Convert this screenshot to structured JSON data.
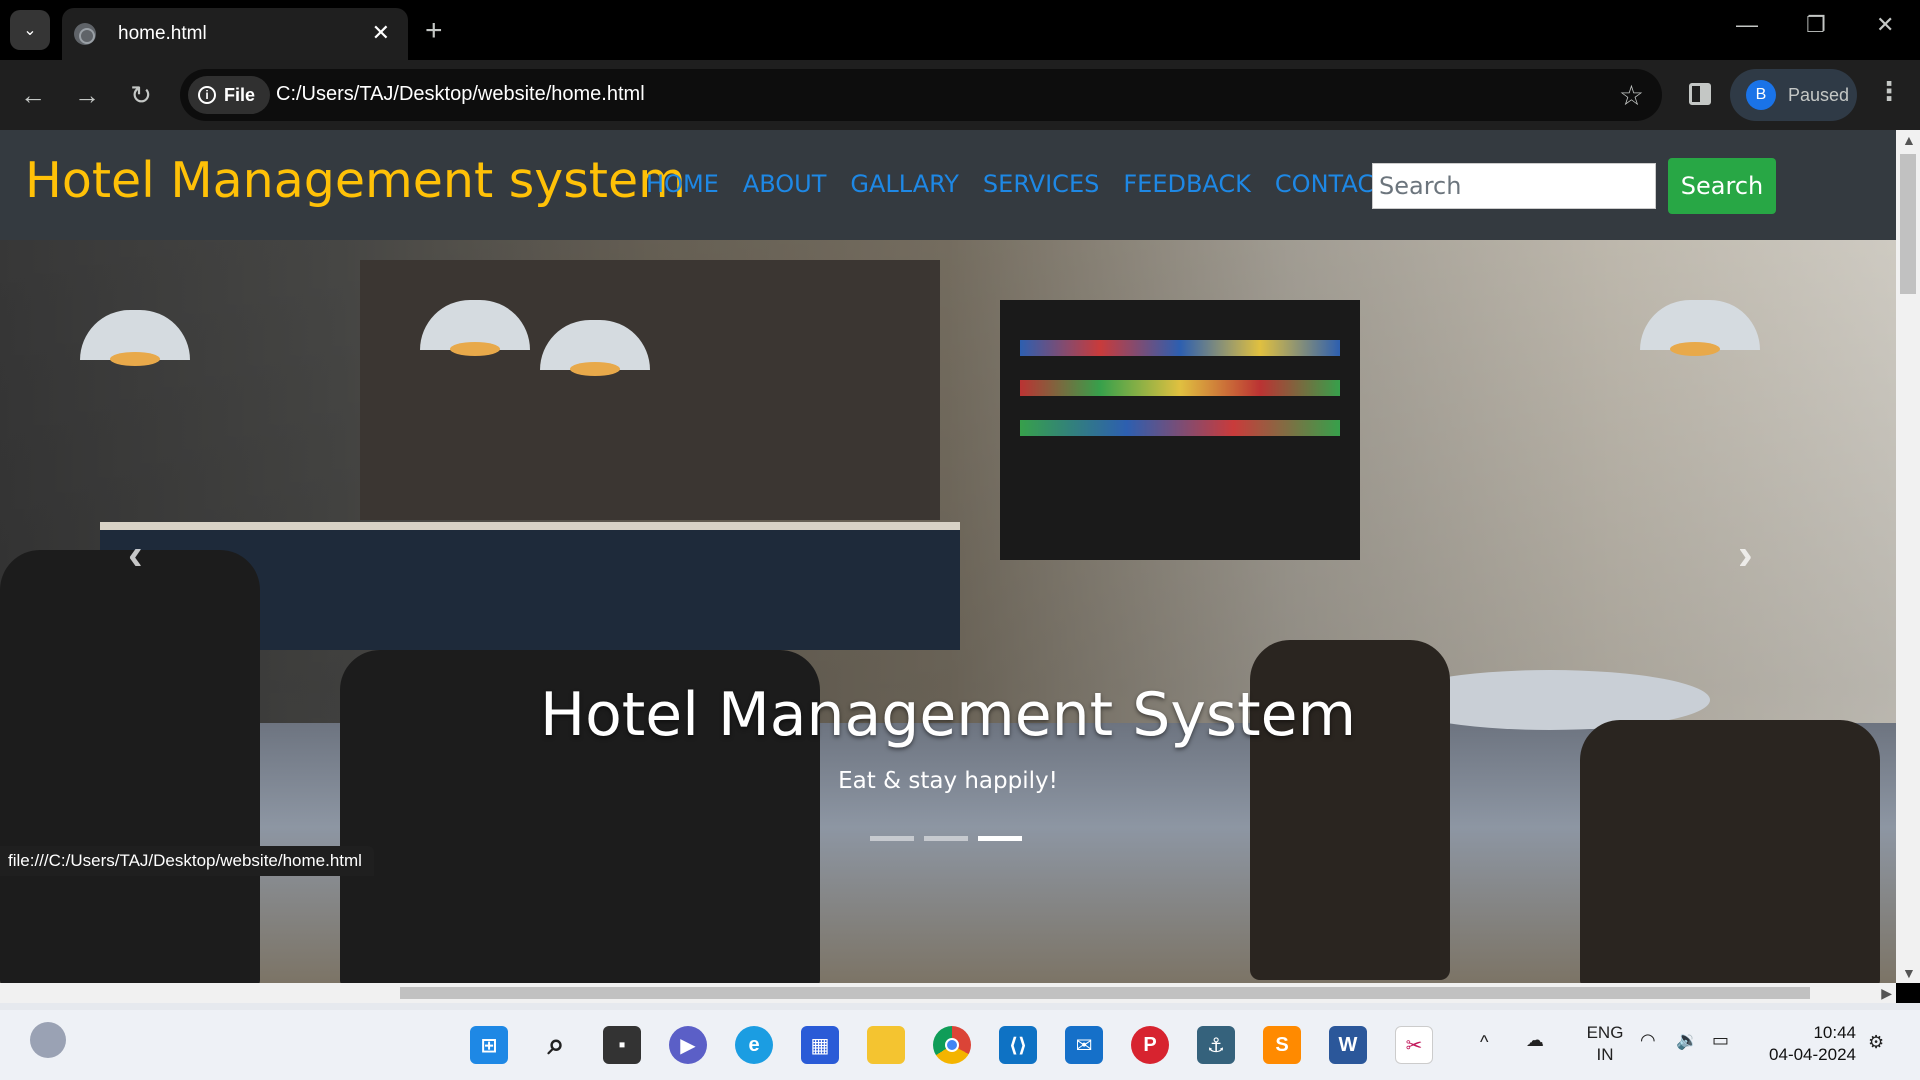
{
  "browser": {
    "tab_title": "home.html",
    "tab_close": "✕",
    "new_tab": "+",
    "site_chip": "File",
    "url": "C:/Users/TAJ/Desktop/website/home.html",
    "profile_initial": "B",
    "profile_status": "Paused",
    "status_bar_url": "file:///C:/Users/TAJ/Desktop/website/home.html"
  },
  "navbar": {
    "brand": "Hotel Management system",
    "links": [
      "HOME",
      "ABOUT",
      "GALLARY",
      "SERVICES",
      "FEEDBACK",
      "CONTACT US"
    ],
    "search_placeholder": "Search",
    "search_button": "Search",
    "colors": {
      "background": "#343a40",
      "brand": "#ffc107",
      "link": "#1e88e5",
      "button": "#28a745"
    }
  },
  "carousel": {
    "caption_title": "Hotel Management System",
    "caption_subtitle": "Eat & stay happily!",
    "prev_glyph": "‹",
    "next_glyph": "›",
    "slide_count": 3,
    "active_slide": 3
  },
  "taskbar": {
    "language_line1": "ENG",
    "language_line2": "IN",
    "time": "10:44",
    "date": "04-04-2024",
    "apps": [
      "windows-start",
      "search",
      "task-view",
      "teams",
      "edge",
      "store",
      "file-explorer",
      "chrome",
      "vscode",
      "mail",
      "pinterest",
      "mysql-workbench",
      "sublime-text",
      "word",
      "snipping-tool"
    ]
  }
}
